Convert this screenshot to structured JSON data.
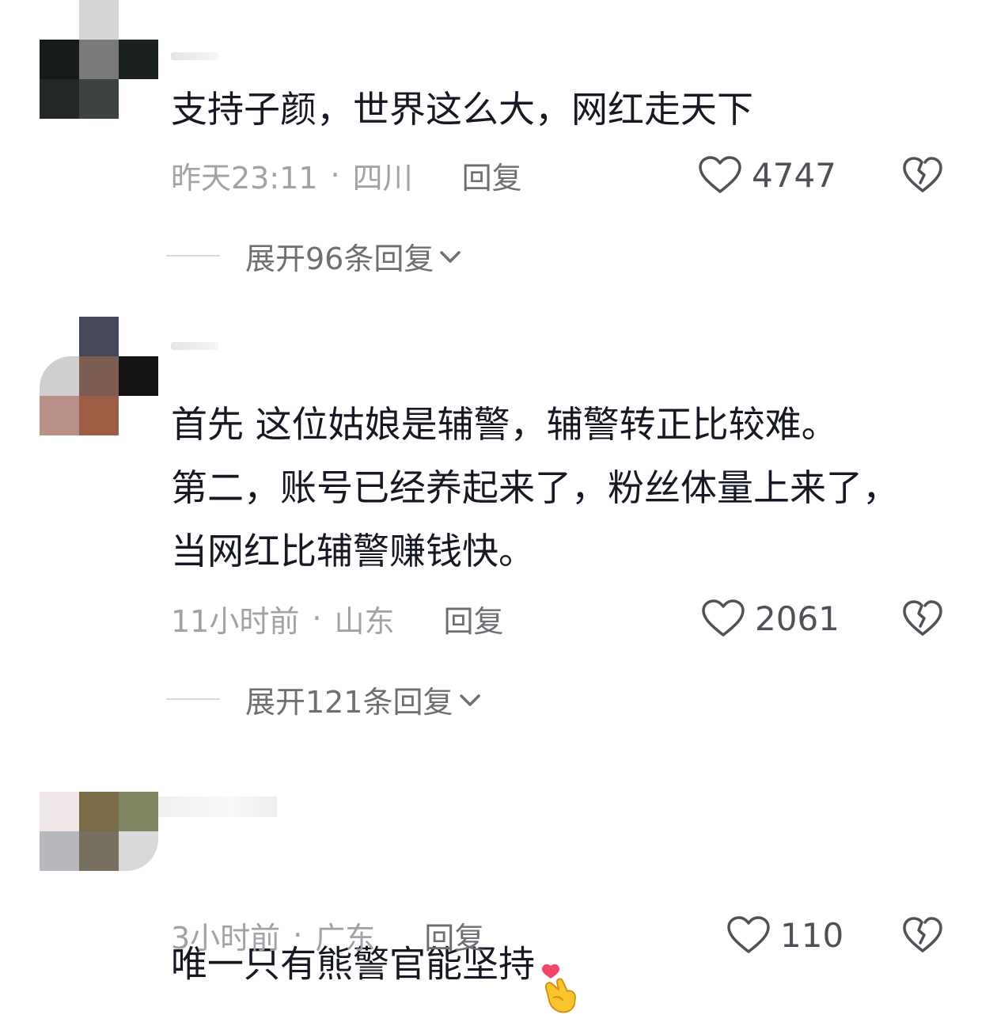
{
  "comments": [
    {
      "text": "支持子颜，世界这么大，网红走天下",
      "time": "昨天23:11",
      "location": "四川",
      "reply_label": "回复",
      "likes": "4747",
      "expand_label": "展开96条回复"
    },
    {
      "text": "首先 这位姑娘是辅警，辅警转正比较难。\n第二，账号已经养起来了，粉丝体量上来了，\n当网红比辅警赚钱快。",
      "time": "11小时前",
      "location": "山东",
      "reply_label": "回复",
      "likes": "2061",
      "expand_label": "展开121条回复"
    },
    {
      "text": "唯一只有熊警官能坚持",
      "time": "3小时前",
      "location": "广东",
      "reply_label": "回复",
      "likes": "110"
    }
  ],
  "meta_separator": "·",
  "icons": {
    "like": "heart-outline-icon",
    "dislike": "broken-heart-icon",
    "expand": "chevron-down-icon",
    "emoji": "finger-heart-emoji"
  },
  "colors": {
    "text": "#161823",
    "meta": "#a1a1a6",
    "reply": "#6e6e73",
    "like": "#505058"
  }
}
